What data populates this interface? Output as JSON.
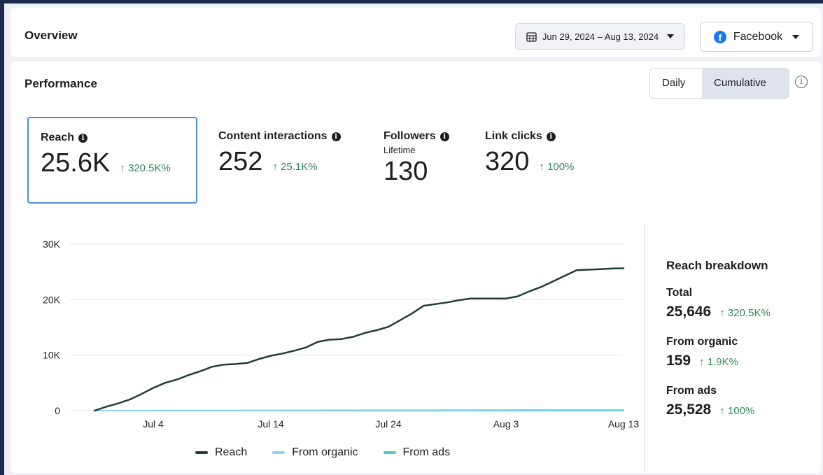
{
  "overview": {
    "title": "Overview",
    "date_range": "Jun 29, 2024 – Aug 13, 2024",
    "platform": "Facebook",
    "icons": {
      "date": "calendar-icon",
      "platform": "facebook-logo-icon",
      "dropdown": "caret-down-icon"
    }
  },
  "performance": {
    "title": "Performance",
    "toggle": {
      "daily": "Daily",
      "cumulative": "Cumulative",
      "selected": "Cumulative"
    },
    "metrics": [
      {
        "label": "Reach",
        "value": "25.6K",
        "change": "↑ 320.5K%",
        "sub": "",
        "selected": true
      },
      {
        "label": "Content interactions",
        "value": "252",
        "change": "↑ 25.1K%",
        "sub": ""
      },
      {
        "label": "Followers",
        "value": "130",
        "change": "",
        "sub": "Lifetime"
      },
      {
        "label": "Link clicks",
        "value": "320",
        "change": "↑ 100%",
        "sub": ""
      }
    ]
  },
  "breakdown": {
    "title": "Reach breakdown",
    "total": {
      "label": "Total",
      "value": "25,646",
      "change": "↑ 320.5K%"
    },
    "organic": {
      "label": "From organic",
      "value": "159",
      "change": "↑ 1.9K%"
    },
    "ads": {
      "label": "From ads",
      "value": "25,528",
      "change": "↑ 100%"
    }
  },
  "colors": {
    "reach": "#1f3d36",
    "organic": "#8fd3f5",
    "ads": "#4dc9cc",
    "positive": "#2e8b57",
    "selected_border": "#4a90d9"
  },
  "chart_data": {
    "type": "line",
    "ylim": [
      0,
      30000
    ],
    "yticks": [
      "0",
      "10K",
      "20K",
      "30K"
    ],
    "ytick_values": [
      0,
      10000,
      20000,
      30000
    ],
    "xticks": [
      "Jul 4",
      "Jul 14",
      "Jul 24",
      "Aug 3",
      "Aug 13"
    ],
    "xtick_days": [
      5,
      15,
      25,
      35,
      45
    ],
    "grid": true,
    "legend_position": "bottom",
    "x": [
      0,
      1,
      2,
      3,
      4,
      5,
      6,
      7,
      8,
      9,
      10,
      11,
      12,
      13,
      14,
      15,
      16,
      17,
      18,
      19,
      20,
      21,
      22,
      23,
      24,
      25,
      26,
      27,
      28,
      29,
      30,
      31,
      32,
      33,
      34,
      35,
      36,
      37,
      38,
      39,
      40,
      41,
      42,
      43,
      44,
      45
    ],
    "series": [
      {
        "name": "Reach",
        "values": [
          0,
          700,
          1300,
          2000,
          3000,
          4100,
          5000,
          5600,
          6400,
          7100,
          7900,
          8300,
          8400,
          8600,
          9300,
          9900,
          10300,
          10800,
          11400,
          12400,
          12800,
          12900,
          13300,
          14000,
          14500,
          15100,
          16300,
          17500,
          18900,
          19200,
          19500,
          19900,
          20200,
          20200,
          20200,
          20200,
          20600,
          21500,
          22300,
          23300,
          24300,
          25300,
          25400,
          25500,
          25600,
          25646
        ]
      },
      {
        "name": "From organic",
        "values": [
          0,
          4,
          8,
          12,
          15,
          18,
          22,
          26,
          30,
          34,
          38,
          41,
          44,
          47,
          50,
          54,
          58,
          62,
          65,
          68,
          72,
          75,
          78,
          82,
          86,
          90,
          94,
          98,
          102,
          106,
          110,
          114,
          118,
          122,
          126,
          130,
          134,
          138,
          142,
          145,
          148,
          151,
          154,
          156,
          158,
          159
        ]
      },
      {
        "name": "From ads",
        "values": [
          0,
          0,
          0,
          0,
          0,
          0,
          0,
          0,
          0,
          0,
          0,
          0,
          0,
          0,
          0,
          0,
          0,
          0,
          0,
          0,
          0,
          0,
          0,
          0,
          0,
          0,
          0,
          0,
          0,
          0,
          0,
          0,
          0,
          0,
          0,
          0,
          0,
          0,
          0,
          0,
          0,
          0,
          0,
          0,
          0,
          0
        ]
      }
    ]
  }
}
